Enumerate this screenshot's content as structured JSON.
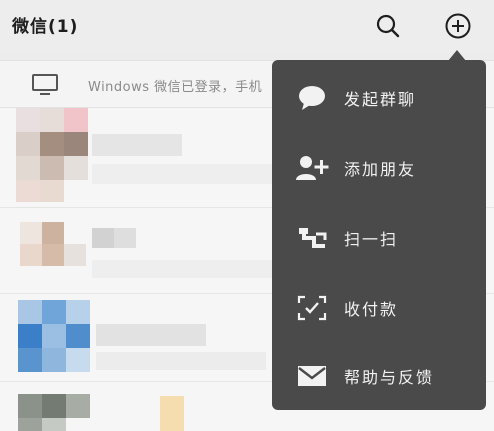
{
  "header": {
    "title": "微信(1)",
    "icons": [
      "search-icon",
      "add-icon"
    ]
  },
  "login_notice": {
    "icon": "monitor-icon",
    "text": "Windows 微信已登录，手机"
  },
  "menu": {
    "items": [
      {
        "icon": "chat-bubble-icon",
        "label": "发起群聊"
      },
      {
        "icon": "add-friend-icon",
        "label": "添加朋友"
      },
      {
        "icon": "scan-icon",
        "label": "扫一扫"
      },
      {
        "icon": "payment-qr-icon",
        "label": "收付款"
      },
      {
        "icon": "mail-icon",
        "label": "帮助与反馈"
      }
    ]
  },
  "colors": {
    "menu_bg": "#4a4a4a",
    "menu_text": "#f2f2f2",
    "topbar_bg": "#ededed"
  }
}
